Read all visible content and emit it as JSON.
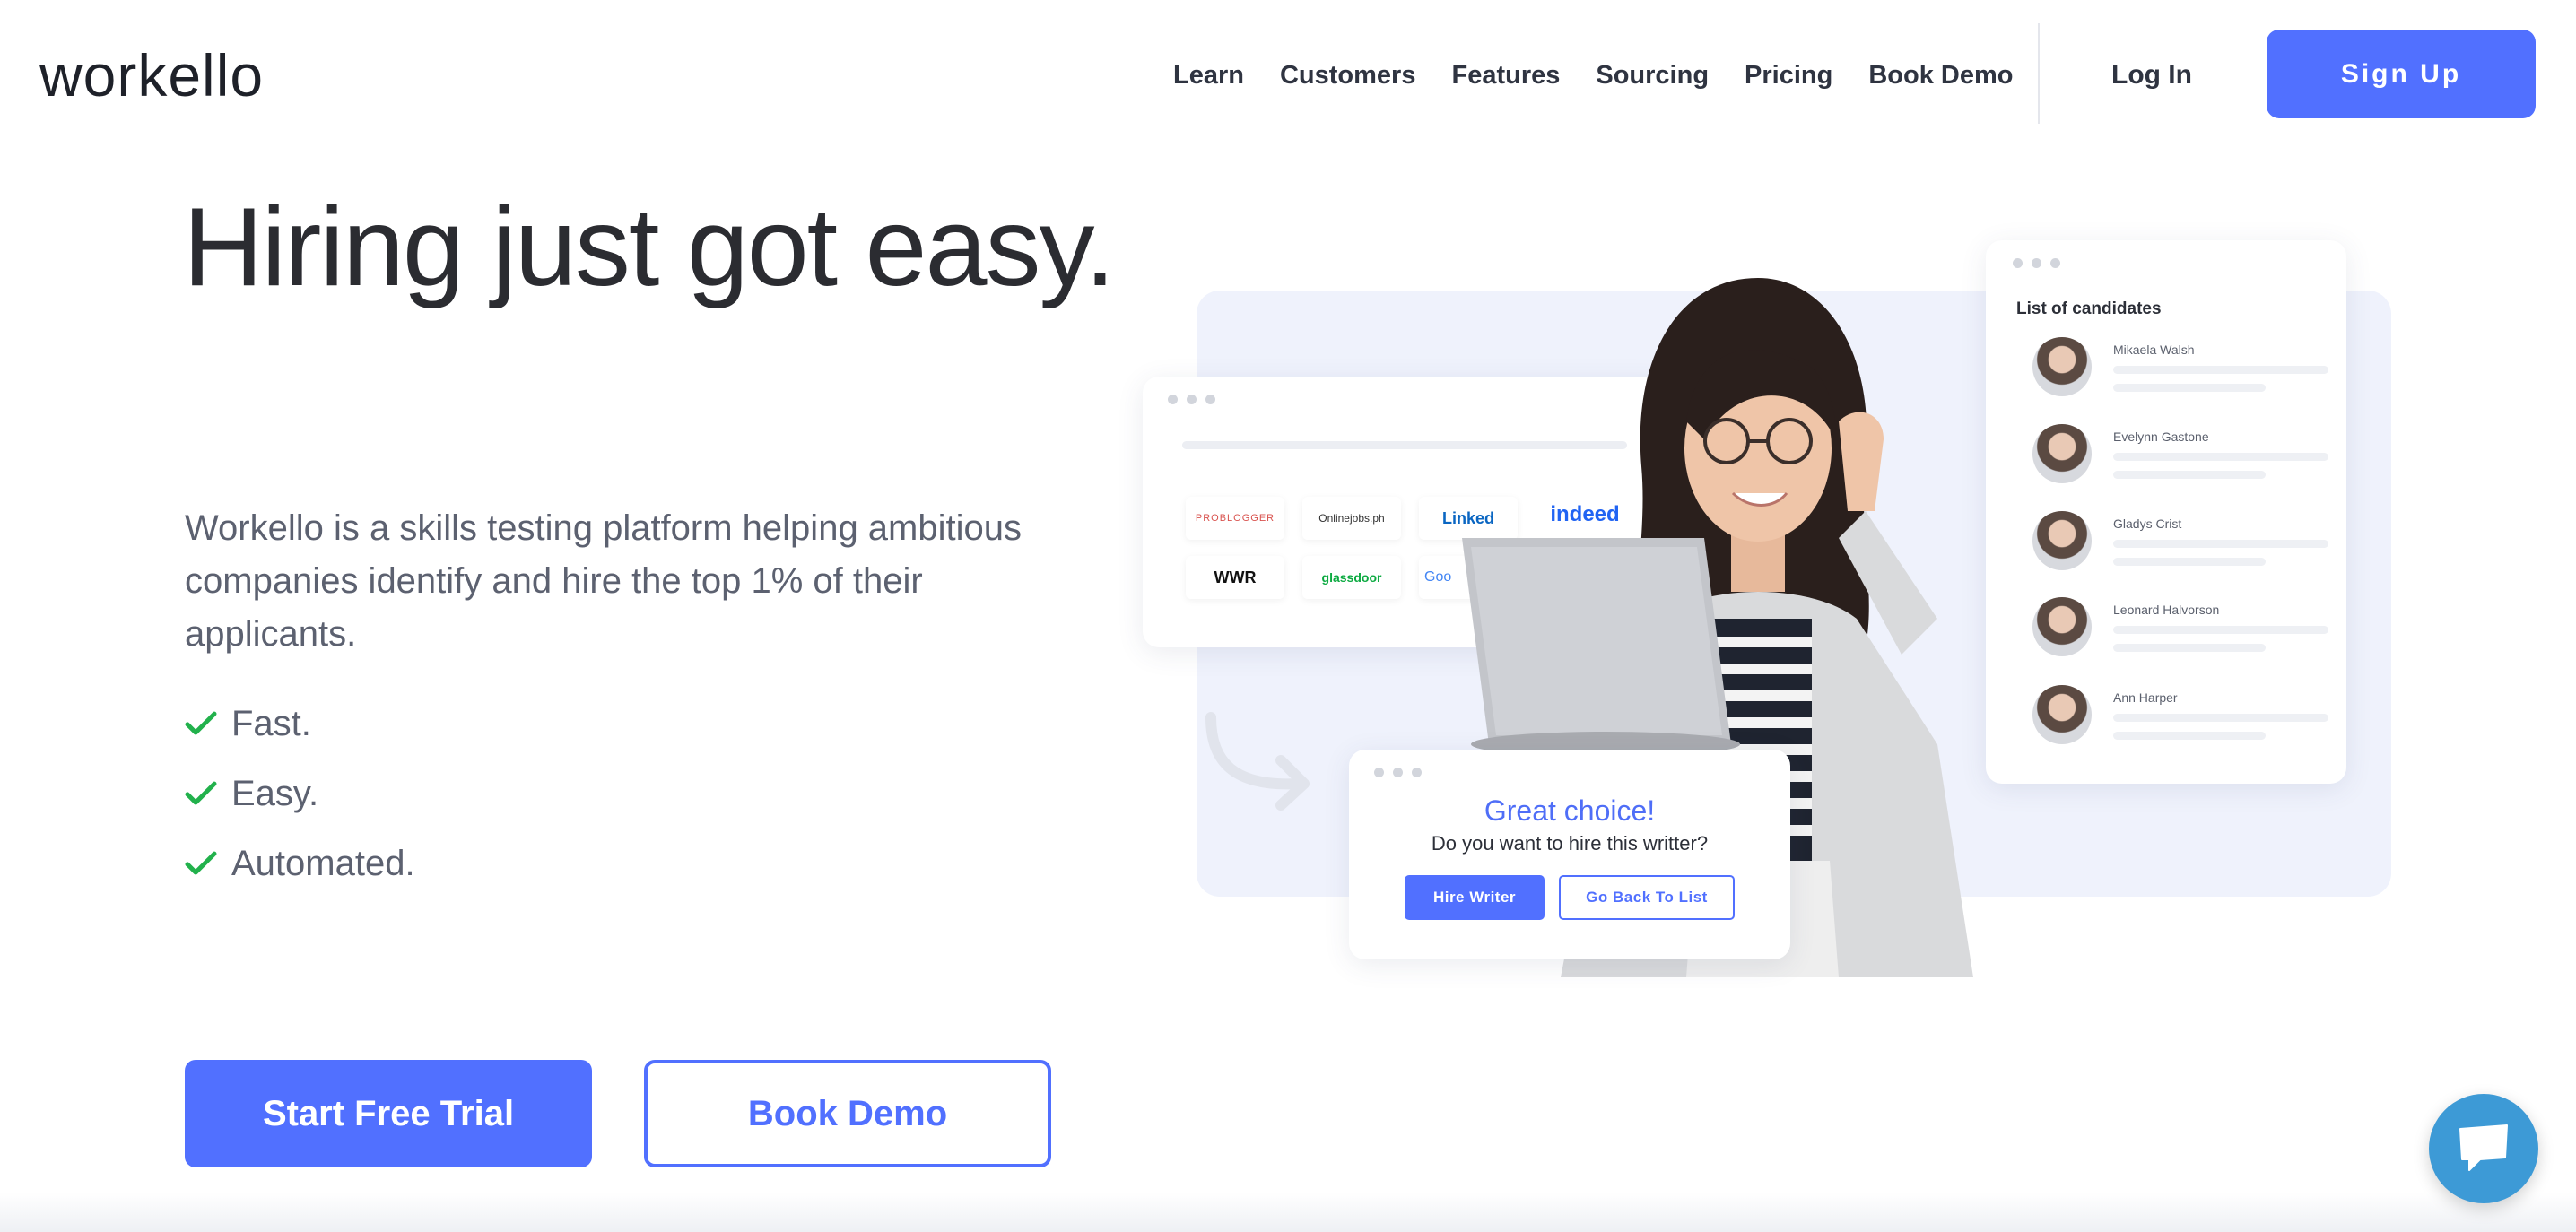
{
  "header": {
    "logo": "workello",
    "nav": [
      "Learn",
      "Customers",
      "Features",
      "Sourcing",
      "Pricing",
      "Book Demo"
    ],
    "login_label": "Log In",
    "signup_label": "Sign Up"
  },
  "hero": {
    "title": "Hiring just got easy.",
    "description": "Workello is a skills testing platform helping ambitious companies identify and hire the top 1% of their applicants.",
    "features": [
      "Fast.",
      "Easy.",
      "Automated."
    ],
    "primary_cta": "Start Free Trial",
    "secondary_cta": "Book Demo"
  },
  "illustration": {
    "job_boards": [
      "PROBLOGGER",
      "Onlinejobs.ph",
      "Linked",
      "indeed",
      "WWR",
      "glassdoor",
      "Goo"
    ],
    "candidates_title": "List of candidates",
    "candidates": [
      "Mikaela Walsh",
      "Evelynn Gastone",
      "Gladys Crist",
      "Leonard Halvorson",
      "Ann Harper"
    ],
    "choice_title": "Great choice!",
    "choice_subtitle": "Do  you want to hire this writter?",
    "hire_label": "Hire Writer",
    "back_label": "Go Back To List"
  },
  "colors": {
    "accent": "#5170ff",
    "check": "#22b14c",
    "chat": "#3d9ad6"
  },
  "icons": {
    "feature_check": "check-icon",
    "chat": "chat-bubble-icon",
    "arrow": "curved-arrow-icon"
  }
}
